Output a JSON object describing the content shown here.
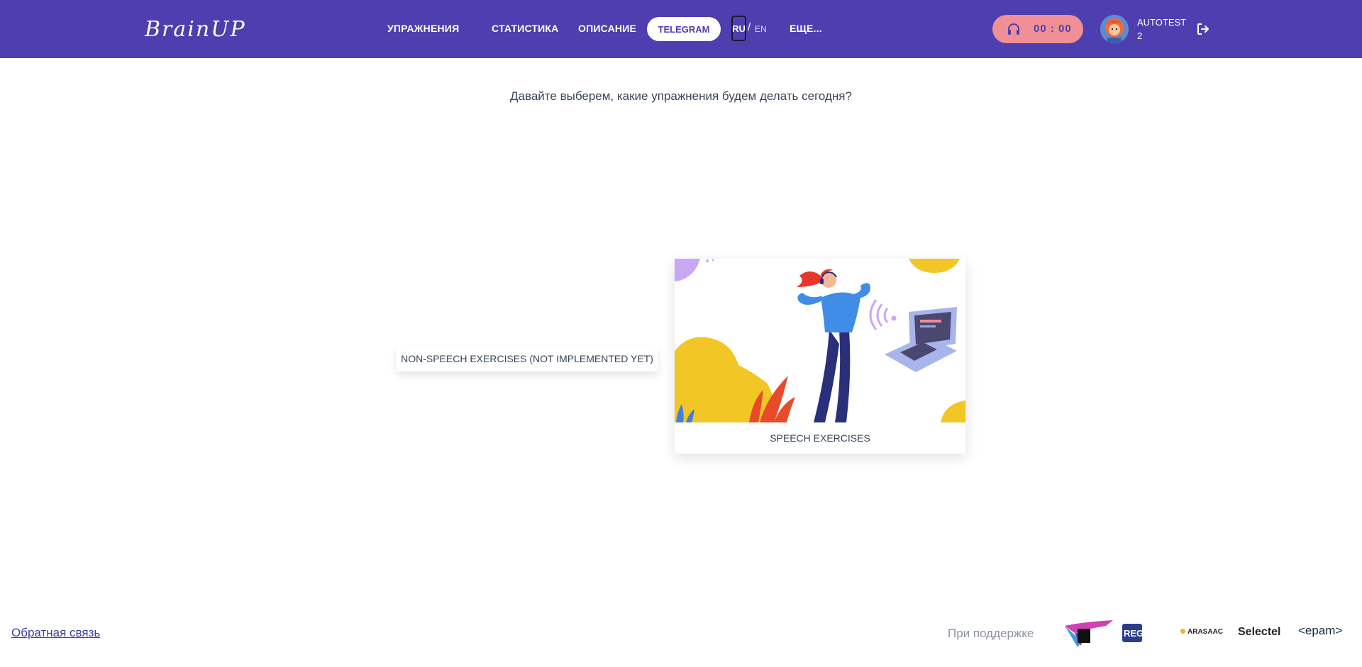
{
  "header": {
    "logo": "BrainUP",
    "nav": {
      "exercises": "УПРАЖНЕНИЯ",
      "statistics": "СТАТИСТИКА",
      "description": "ОПИСАНИЕ",
      "telegram": "TELEGRAM",
      "more": "ЕЩЕ..."
    },
    "lang": {
      "ru": "RU",
      "separator": "/",
      "en": "EN"
    },
    "timer": {
      "icon": "headphones-icon",
      "value": "00 : 00"
    },
    "user": {
      "name_line1": "AUTOTEST",
      "name_line2": "2"
    },
    "logout_icon": "logout-icon"
  },
  "main": {
    "prompt": "Давайте выберем, какие упражнения будем делать сегодня?",
    "cards": [
      {
        "label": "NON-SPEECH EXERCISES (NOT IMPLEMENTED YET)"
      },
      {
        "label": "SPEECH EXERCISES"
      }
    ]
  },
  "footer": {
    "feedback": "Обратная связь",
    "support": "При поддержке",
    "sponsors": {
      "reg_ru": "REG.RU",
      "arasaac": "ARASAAC",
      "selectel": "Selectel",
      "epam": "<epam>"
    }
  },
  "colors": {
    "header_bg": "#4e3fb0",
    "timer_bg": "#f08f96",
    "text_main": "#3a4656",
    "link": "#3d3f9e"
  }
}
